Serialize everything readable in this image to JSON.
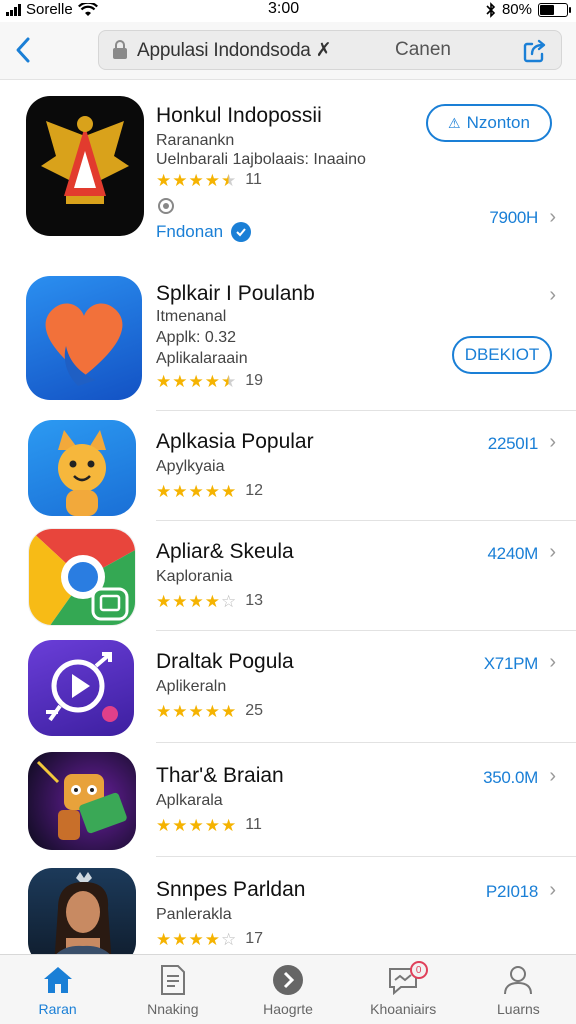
{
  "status_bar": {
    "carrier": "Sorelle",
    "time": "3:00",
    "battery": "80%"
  },
  "nav": {
    "search_text": "Appulasi Indondsoda ✗",
    "cancel": "Canen"
  },
  "apps": [
    {
      "title": "Honkul Indopossii",
      "line1": "Raranankn",
      "line2": "Uelnbarali 1ajbolaais: Inaaino",
      "rating": 4.5,
      "count": "11",
      "button": "Nzonton",
      "price": "7900H",
      "developer": "Fndonan"
    },
    {
      "title": "Splkair I Poulanb",
      "line1": "Itmenanal",
      "line2": "Applk: 0.32",
      "line3": "Aplikalaraain",
      "rating": 4.5,
      "count": "19",
      "button": "DBEKIOT"
    },
    {
      "title": "Aplkasia Popular",
      "line1": "Apylkyaia",
      "rating": 5,
      "count": "12",
      "price": "2250I1"
    },
    {
      "title": "Apliar& Skeula",
      "line1": "Kaplorania",
      "rating": 4,
      "count": "13",
      "price": "4240M"
    },
    {
      "title": "Draltak Pogula",
      "line1": "Aplikeraln",
      "rating": 5,
      "count": "25",
      "price": "X71PM"
    },
    {
      "title": "Thar'& Braian",
      "line1": "Aplkarala",
      "rating": 5,
      "count": "11",
      "price": "350.0M"
    },
    {
      "title": "Snnpes Parldan",
      "line1": "Panlerakla",
      "rating": 4,
      "count": "17",
      "price": "P2I018"
    }
  ],
  "tabs": [
    {
      "label": "Raran",
      "icon": "home-icon",
      "active": true
    },
    {
      "label": "Nnaking",
      "icon": "document-icon",
      "active": false
    },
    {
      "label": "Haogrte",
      "icon": "arrow-circle-icon",
      "active": false
    },
    {
      "label": "Khoaniairs",
      "icon": "chat-icon",
      "active": false,
      "badge": "0"
    },
    {
      "label": "Luarns",
      "icon": "person-icon",
      "active": false
    }
  ],
  "colors": {
    "accent": "#1a7fd6",
    "star": "#f5b301"
  }
}
